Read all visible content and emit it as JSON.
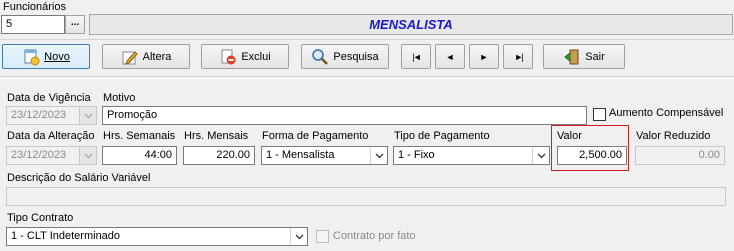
{
  "header": {
    "funcionarios_label": "Funcionários",
    "funcionario_code": "5",
    "lookup_button": "...",
    "tipo_title": "MENSALISTA"
  },
  "toolbar": {
    "novo": "Novo",
    "altera": "Altera",
    "exclui": "Exclui",
    "pesquisa": "Pesquisa",
    "first": "|◄",
    "prev": "◄",
    "next": "►",
    "last": "►|",
    "sair": "Sair"
  },
  "form": {
    "data_vigencia_label": "Data de Vigência",
    "data_vigencia_value": "23/12/2023",
    "motivo_label": "Motivo",
    "motivo_value": "Promoção",
    "aumento_label": "Aumento Compensável",
    "data_alteracao_label": "Data da Alteração",
    "data_alteracao_value": "23/12/2023",
    "hrs_semanais_label": "Hrs. Semanais",
    "hrs_semanais_value": "44:00",
    "hrs_mensais_label": "Hrs. Mensais",
    "hrs_mensais_value": "220.00",
    "forma_pagamento_label": "Forma de Pagamento",
    "forma_pagamento_value": "1  -  Mensalista",
    "tipo_pagamento_label": "Tipo de Pagamento",
    "tipo_pagamento_value": "1 - Fixo",
    "valor_label": "Valor",
    "valor_value": "2,500.00",
    "valor_reduzido_label": "Valor Reduzido",
    "valor_reduzido_value": "0.00",
    "descricao_label": "Descrição do Salário Variável",
    "descricao_value": "",
    "tipo_contrato_label": "Tipo Contrato",
    "tipo_contrato_value": "1  -  CLT Indeterminado",
    "contrato_por_fato_label": "Contrato por fato"
  },
  "colors": {
    "title_blue": "#1a1acc",
    "highlight_red": "#d02020",
    "selected_border": "#3c7fb1"
  }
}
